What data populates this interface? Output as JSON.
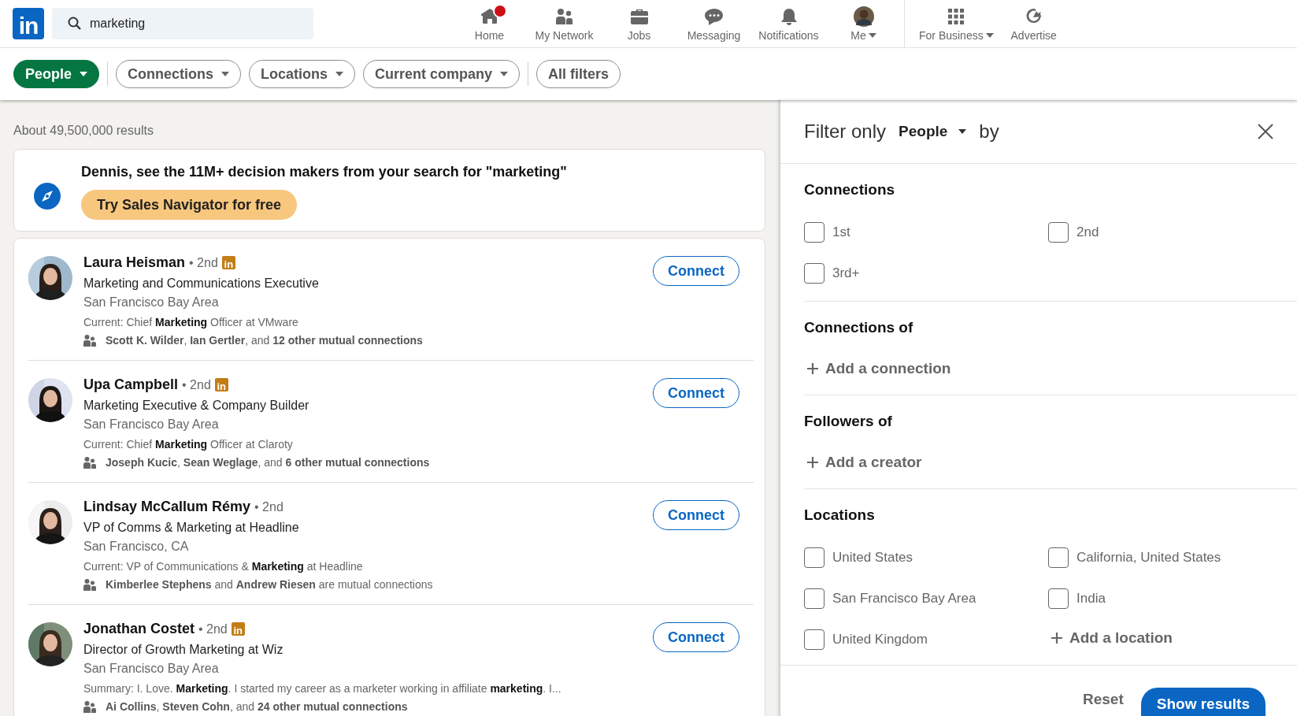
{
  "logo": "in",
  "search": {
    "value": "marketing"
  },
  "nav": [
    {
      "label": "Home",
      "kind": "home",
      "notification": true,
      "dropdown": false
    },
    {
      "label": "My Network",
      "kind": "network",
      "notification": false,
      "dropdown": false
    },
    {
      "label": "Jobs",
      "kind": "jobs",
      "notification": false,
      "dropdown": false
    },
    {
      "label": "Messaging",
      "kind": "messaging",
      "notification": false,
      "dropdown": false
    },
    {
      "label": "Notifications",
      "kind": "notifications",
      "notification": false,
      "dropdown": false
    },
    {
      "label": "Me",
      "kind": "me",
      "notification": false,
      "dropdown": true
    }
  ],
  "nav_secondary": [
    {
      "label": "For Business",
      "kind": "business",
      "dropdown": true
    },
    {
      "label": "Advertise",
      "kind": "advertise",
      "dropdown": false
    }
  ],
  "filters": [
    {
      "label": "People",
      "selected": true,
      "dropdown": true
    },
    {
      "label": "Connections",
      "selected": false,
      "dropdown": true
    },
    {
      "label": "Locations",
      "selected": false,
      "dropdown": true
    },
    {
      "label": "Current company",
      "selected": false,
      "dropdown": true
    },
    {
      "label": "All filters",
      "selected": false,
      "dropdown": false
    }
  ],
  "results_count": "About 49,500,000 results",
  "promo": {
    "text": "Dennis, see the 11M+ decision makers from your search for \"marketing\"",
    "button": "Try Sales Navigator for free"
  },
  "results": [
    {
      "name": "Laura Heisman",
      "degree": "• 2nd",
      "badge": "in",
      "headline": "Marketing and Communications Executive",
      "location": "San Francisco Bay Area",
      "snippet": "Current: Chief **Marketing** Officer at VMware",
      "mutual": "**Scott K. Wilder**, **Ian Gertler**, and **12 other mutual connections**",
      "button": "Connect"
    },
    {
      "name": "Upa Campbell",
      "degree": "• 2nd",
      "badge": "in",
      "headline": "Marketing Executive & Company Builder",
      "location": "San Francisco Bay Area",
      "snippet": "Current: Chief **Marketing** Officer at Claroty",
      "mutual": "**Joseph Kucic**, **Sean Weglage**, and **6 other mutual connections**",
      "button": "Connect"
    },
    {
      "name": "Lindsay McCallum Rémy",
      "degree": "• 2nd",
      "headline": "VP of Comms & Marketing at Headline",
      "location": "San Francisco, CA",
      "snippet": "Current: VP of Communications & **Marketing** at Headline",
      "mutual": "**Kimberlee Stephens** and **Andrew Riesen** are mutual connections",
      "button": "Connect"
    },
    {
      "name": "Jonathan Costet",
      "degree": "• 2nd",
      "badge": "in",
      "headline": "Director of Growth Marketing at Wiz",
      "location": "San Francisco Bay Area",
      "snippet": "Summary: I. Love. **Marketing**. I started my career as a marketer working in affiliate **marketing**. I...",
      "mutual": "**Ai Collins**, **Steven Cohn**, and **24 other mutual connections**",
      "button": "Connect"
    }
  ],
  "filter_panel": {
    "title_prefix": "Filter only",
    "type": "People",
    "title_suffix": "by",
    "sections": [
      {
        "title": "Connections",
        "options": [
          {
            "label": "1st",
            "checked": false
          },
          {
            "label": "2nd",
            "checked": false
          },
          {
            "label": "3rd+",
            "checked": false
          }
        ]
      },
      {
        "title": "Connections of",
        "add": "Add a connection"
      },
      {
        "title": "Followers of",
        "add": "Add a creator"
      },
      {
        "title": "Locations",
        "options": [
          {
            "label": "United States",
            "checked": false
          },
          {
            "label": "California, United States",
            "checked": false
          },
          {
            "label": "San Francisco Bay Area",
            "checked": false
          },
          {
            "label": "India",
            "checked": false
          },
          {
            "label": "United Kingdom",
            "checked": false
          }
        ],
        "add": "Add a location"
      }
    ],
    "reset": "Reset",
    "show": "Show results"
  }
}
